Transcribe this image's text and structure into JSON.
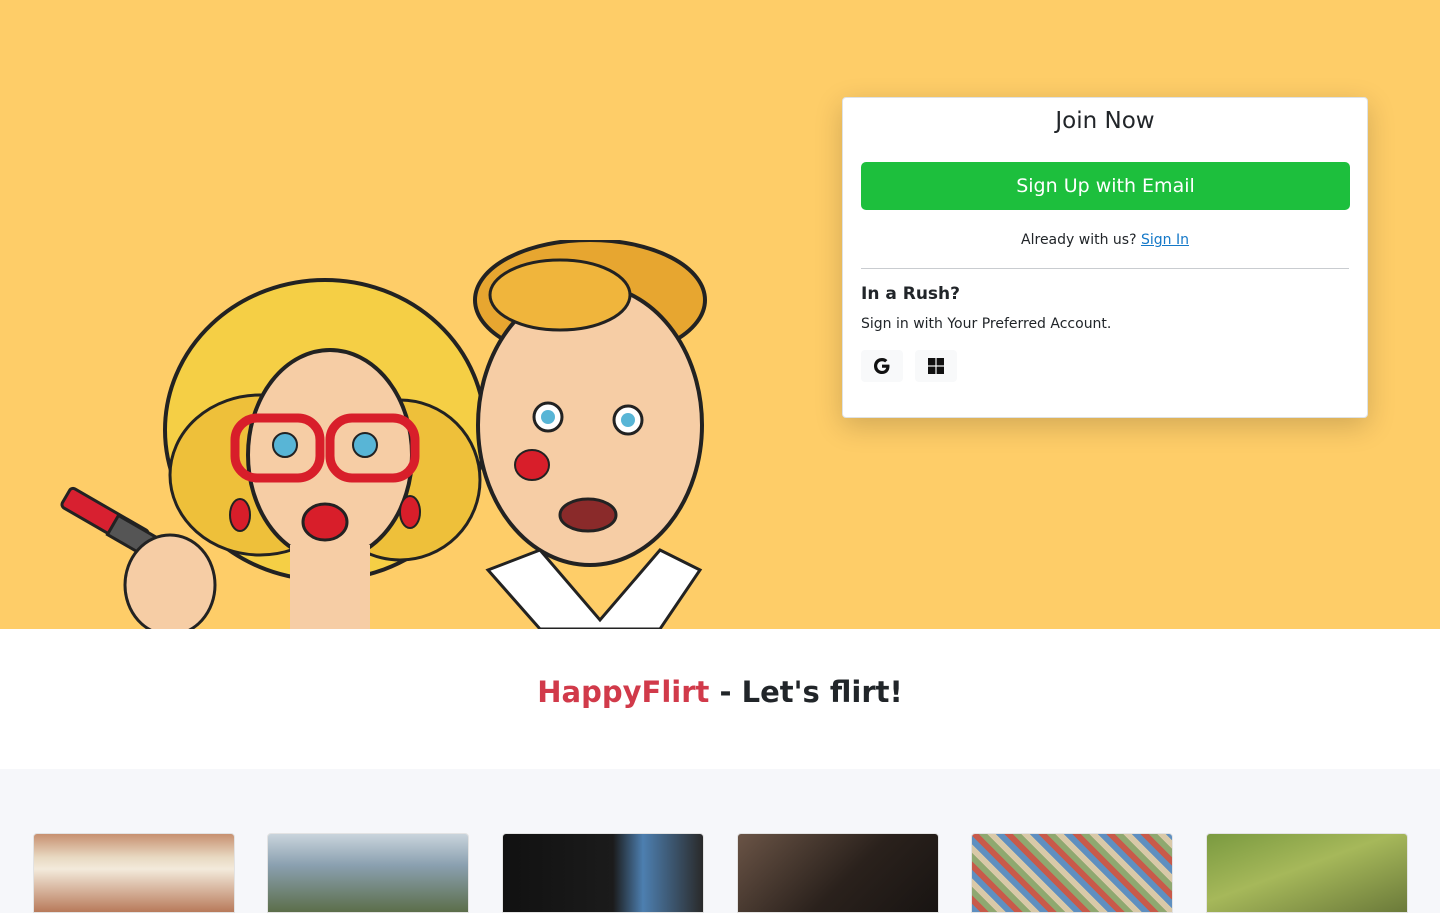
{
  "join": {
    "title": "Join Now",
    "signup_email_label": "Sign Up with Email",
    "already_text": "Already with us? ",
    "signin_link": "Sign In"
  },
  "rush": {
    "title": "In a Rush?",
    "subtitle": "Sign in with Your Preferred Account."
  },
  "social": [
    "google-icon",
    "windows-icon"
  ],
  "tagline": {
    "brand": "HappyFlirt",
    "rest": " - Let's flirt!"
  },
  "colors": {
    "hero_bg": "#fecd68",
    "signup_button": "#1dbf3d",
    "brand": "#d13a4a",
    "link": "#1478c8"
  },
  "gallery": {
    "photo_count": 6
  }
}
